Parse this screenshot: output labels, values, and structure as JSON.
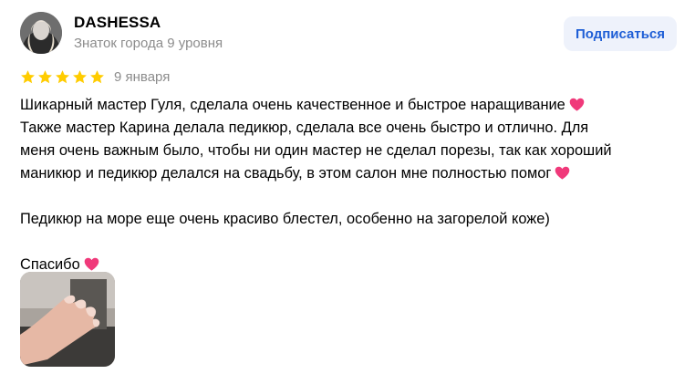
{
  "author": {
    "name": "DASHESSA",
    "level": "Знаток города 9 уровня"
  },
  "subscribe_label": "Подписаться",
  "review": {
    "rating": 5,
    "rating_max": 5,
    "date": "9 января",
    "lines": [
      "Шикарный мастер Гуля, сделала очень качественное и быстрое наращивание",
      "Также мастер Карина делала педикюр, сделала все очень быстро и отлично. Для",
      "меня очень важным было, чтобы ни один мастер не сделал порезы, так как хороший",
      "маникюр и педикюр делался на свадьбу, в этом салон мне полностью помог",
      "Педикюр на море еще очень красиво блестел, особенно на загорелой коже)",
      "Спасибо"
    ]
  },
  "colors": {
    "star": "#ffcc00",
    "heart": "#f0397a",
    "accent": "#1f5fd6",
    "secondary_text": "#8c8c8c"
  },
  "icons": {
    "star": "star-icon",
    "heart": "heart-icon"
  }
}
